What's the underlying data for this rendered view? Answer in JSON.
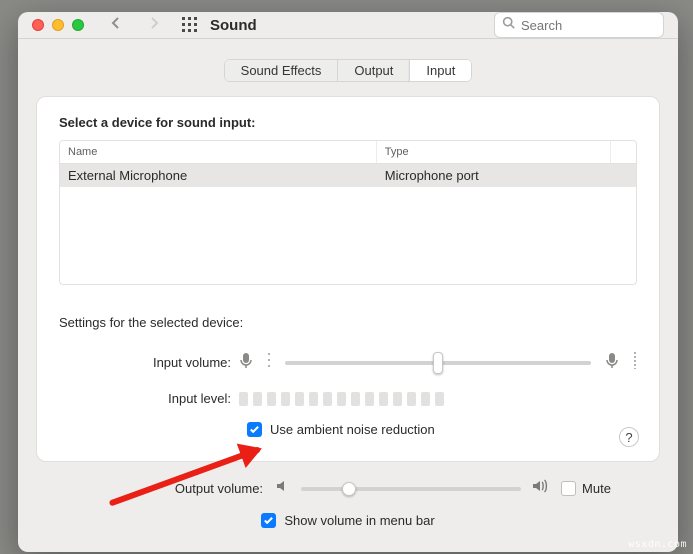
{
  "window": {
    "title": "Sound"
  },
  "search": {
    "placeholder": "Search"
  },
  "tabs": [
    {
      "label": "Sound Effects",
      "active": false
    },
    {
      "label": "Output",
      "active": false
    },
    {
      "label": "Input",
      "active": true
    }
  ],
  "input_section": {
    "heading": "Select a device for sound input:",
    "columns": {
      "name": "Name",
      "type": "Type"
    },
    "rows": [
      {
        "name": "External Microphone",
        "type": "Microphone port",
        "selected": true
      }
    ]
  },
  "settings": {
    "heading": "Settings for the selected device:",
    "input_volume_label": "Input volume:",
    "input_volume_percent": 50,
    "input_level_label": "Input level:",
    "noise_reduction": {
      "checked": true,
      "label": "Use ambient noise reduction"
    }
  },
  "output": {
    "label": "Output volume:",
    "percent": 22,
    "mute": {
      "checked": false,
      "label": "Mute"
    }
  },
  "menu_bar": {
    "checked": true,
    "label": "Show volume in menu bar"
  },
  "help_glyph": "?",
  "watermark": "wsxdn.com"
}
